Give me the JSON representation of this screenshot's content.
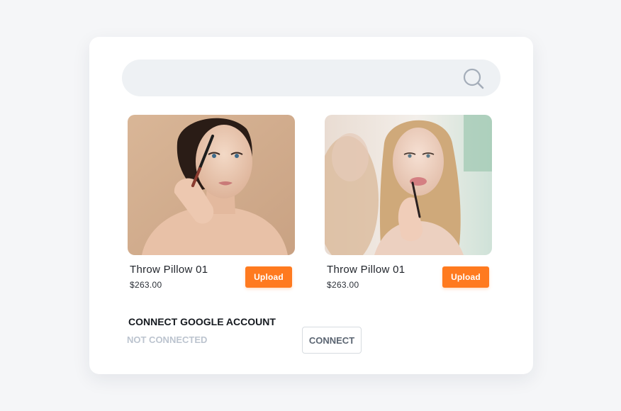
{
  "search": {
    "value": "",
    "placeholder": "",
    "icon": "search-icon"
  },
  "products": [
    {
      "name": "Throw Pillow 01",
      "price": "$263.00",
      "button_label": "Upload",
      "image": "photo-woman-applying-mascara"
    },
    {
      "name": "Throw Pillow 01",
      "price": "$263.00",
      "button_label": "Upload",
      "image": "photo-woman-applying-lip-liner-mirror"
    }
  ],
  "google": {
    "title": "CONNECT GOOGLE ACCOUNT",
    "status": "NOT CONNECTED",
    "button_label": "CONNECT"
  },
  "colors": {
    "accent": "#ff7a1f",
    "page_background": "#f5f6f8",
    "card_background": "#ffffff",
    "search_background": "#eef1f4",
    "status_muted": "#bcc4cf"
  }
}
